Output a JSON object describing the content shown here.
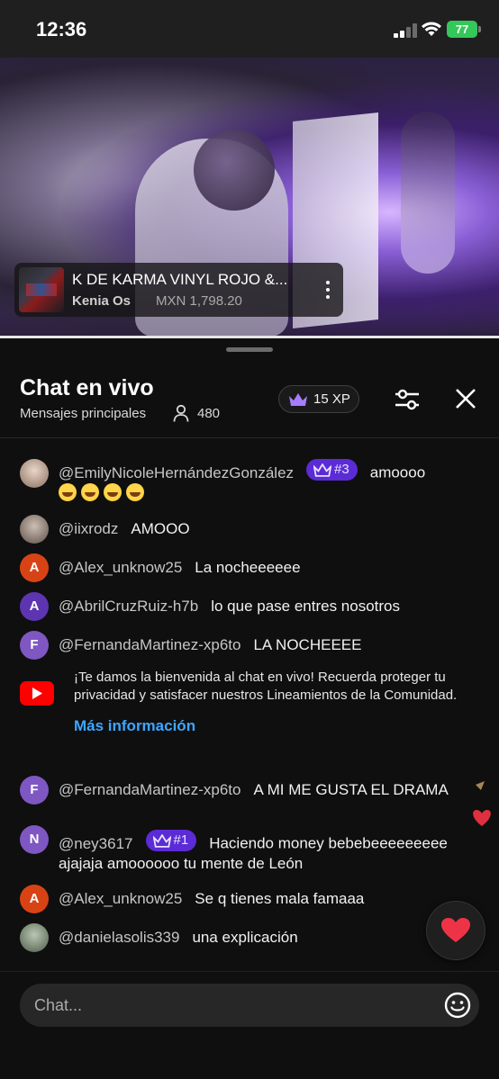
{
  "status_bar": {
    "time": "12:36",
    "battery": "77"
  },
  "video": {
    "product": {
      "title": "K DE KARMA VINYL ROJO &...",
      "seller": "Kenia Os",
      "price": "MXN 1,798.20"
    }
  },
  "chat": {
    "title": "Chat en vivo",
    "subtitle": "Mensajes principales",
    "viewers": "480",
    "xp": "15 XP",
    "messages": [
      {
        "author": "@EmilyNicoleHernándezGonzález",
        "badge": "#3",
        "text": "amoooo",
        "avatar_color": "#b49a8c"
      },
      {
        "author": "@iixrodz",
        "text": "AMOOO",
        "avatar_color": "#8a7a70"
      },
      {
        "author": "@Alex_unknow25",
        "text": "La nocheeeeee",
        "avatar_letter": "A",
        "avatar_color": "#d84315"
      },
      {
        "author": "@AbrilCruzRuiz-h7b",
        "text": "lo que pase entres nosotros",
        "avatar_letter": "A",
        "avatar_color": "#5e35b1"
      },
      {
        "author": "@FernandaMartinez-xp6to",
        "text": "LA NOCHEEEE",
        "avatar_letter": "F",
        "avatar_color": "#7e57c2"
      },
      {
        "author": "@FernandaMartinez-xp6to",
        "text": "A MI ME GUSTA EL DRAMA",
        "avatar_letter": "F",
        "avatar_color": "#7e57c2"
      },
      {
        "author": "@ney3617",
        "badge": "#1",
        "text": "Haciendo money bebebeeeeeeeee ajajaja amoooooo tu mente de León",
        "avatar_letter": "N",
        "avatar_color": "#7e57c2"
      },
      {
        "author": "@Alex_unknow25",
        "text": "Se q tienes mala famaaa",
        "avatar_letter": "A",
        "avatar_color": "#d84315"
      },
      {
        "author": "@danielasolis339",
        "text": "una explicación",
        "avatar_color": "#6f7f6a"
      }
    ],
    "notice": {
      "text": "¡Te damos la bienvenida al chat en vivo! Recuerda proteger tu privacidad y satisfacer nuestros Lineamientos de la Comunidad.",
      "link": "Más información"
    },
    "input": {
      "placeholder": "Chat..."
    }
  },
  "colors": {
    "youtube_red": "#ff0000",
    "link_blue": "#3ea6ff",
    "badge_purple": "#5b2bd6",
    "battery_green": "#34c759"
  },
  "icons": [
    "crown-icon",
    "person-icon",
    "filter-icon",
    "close-icon",
    "youtube-logo-icon",
    "heart-icon",
    "emoji-icon",
    "more-vert-icon"
  ]
}
